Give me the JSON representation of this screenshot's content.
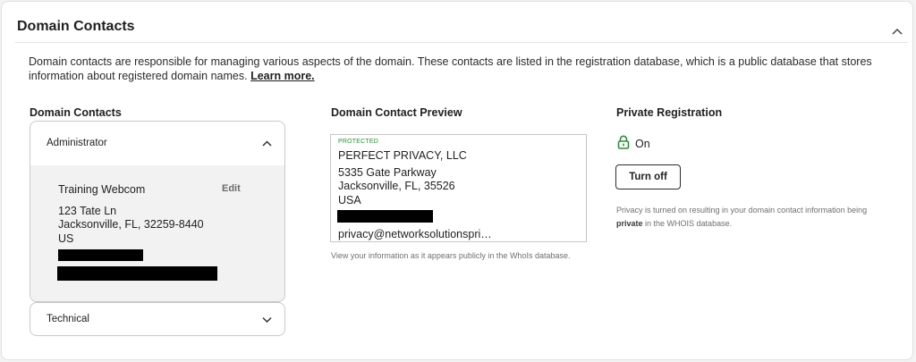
{
  "section": {
    "title": "Domain Contacts",
    "intro_text": "Domain contacts are responsible for managing various aspects of the domain. These contacts are listed in the registration database, which is a public database that stores information about registered domain names.",
    "learn_more": "Learn more."
  },
  "contacts": {
    "heading": "Domain Contacts",
    "administrator": {
      "label": "Administrator",
      "name": "Training Webcom",
      "edit_label": "Edit",
      "address_line1": "123 Tate Ln",
      "address_line2": "Jacksonville, FL, 32259-8440",
      "country": "US"
    },
    "technical": {
      "label": "Technical"
    }
  },
  "preview": {
    "heading": "Domain Contact Preview",
    "badge": "PROTECTED",
    "org": "PERFECT PRIVACY, LLC",
    "address_line1": "5335 Gate Parkway",
    "address_line2": "Jacksonville, FL, 35526",
    "country": "USA",
    "email": "privacy@networksolutionspri…",
    "note": "View your information as it appears publicly in the WhoIs database."
  },
  "private_registration": {
    "heading": "Private Registration",
    "status": "On",
    "button_label": "Turn off",
    "note_pre": "Privacy is turned on resulting in your domain contact information being",
    "note_bold": "private",
    "note_post": "in the WHOIS database.",
    "accent_color": "#2e8b3a"
  }
}
